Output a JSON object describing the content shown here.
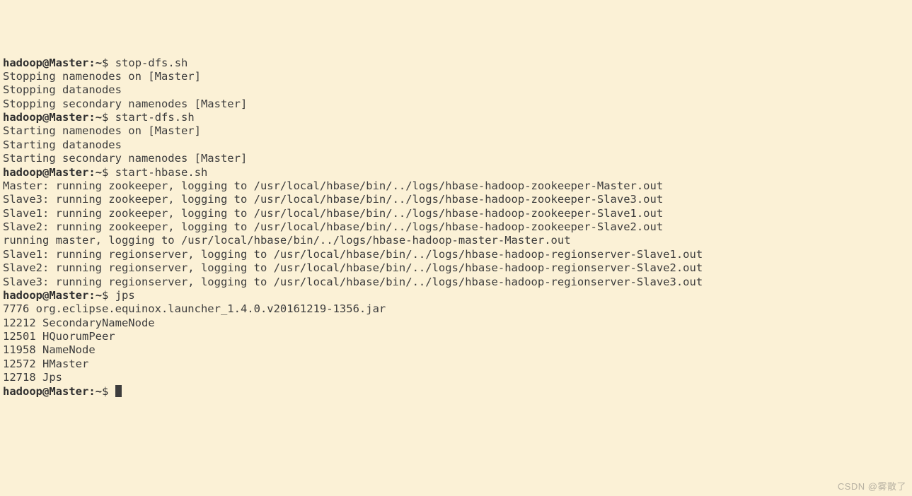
{
  "prompt": {
    "user": "hadoop",
    "host": "Master",
    "path": "~",
    "sep1": "@",
    "sep2": ":",
    "dollar": "$"
  },
  "commands": {
    "stop_dfs": "stop-dfs.sh",
    "start_dfs": "start-dfs.sh",
    "start_hbase": "start-hbase.sh",
    "jps": "jps"
  },
  "stop_dfs_out": [
    "Stopping namenodes on [Master]",
    "Stopping datanodes",
    "Stopping secondary namenodes [Master]"
  ],
  "start_dfs_out": [
    "Starting namenodes on [Master]",
    "Starting datanodes",
    "Starting secondary namenodes [Master]"
  ],
  "start_hbase_out": [
    "Master: running zookeeper, logging to /usr/local/hbase/bin/../logs/hbase-hadoop-zookeeper-Master.out",
    "Slave3: running zookeeper, logging to /usr/local/hbase/bin/../logs/hbase-hadoop-zookeeper-Slave3.out",
    "Slave1: running zookeeper, logging to /usr/local/hbase/bin/../logs/hbase-hadoop-zookeeper-Slave1.out",
    "Slave2: running zookeeper, logging to /usr/local/hbase/bin/../logs/hbase-hadoop-zookeeper-Slave2.out",
    "running master, logging to /usr/local/hbase/bin/../logs/hbase-hadoop-master-Master.out",
    "Slave1: running regionserver, logging to /usr/local/hbase/bin/../logs/hbase-hadoop-regionserver-Slave1.out",
    "Slave2: running regionserver, logging to /usr/local/hbase/bin/../logs/hbase-hadoop-regionserver-Slave2.out",
    "Slave3: running regionserver, logging to /usr/local/hbase/bin/../logs/hbase-hadoop-regionserver-Slave3.out"
  ],
  "jps_out": [
    "7776 org.eclipse.equinox.launcher_1.4.0.v20161219-1356.jar",
    "12212 SecondaryNameNode",
    "12501 HQuorumPeer",
    "11958 NameNode",
    "12572 HMaster",
    "12718 Jps"
  ],
  "watermark": "CSDN @雾散了"
}
